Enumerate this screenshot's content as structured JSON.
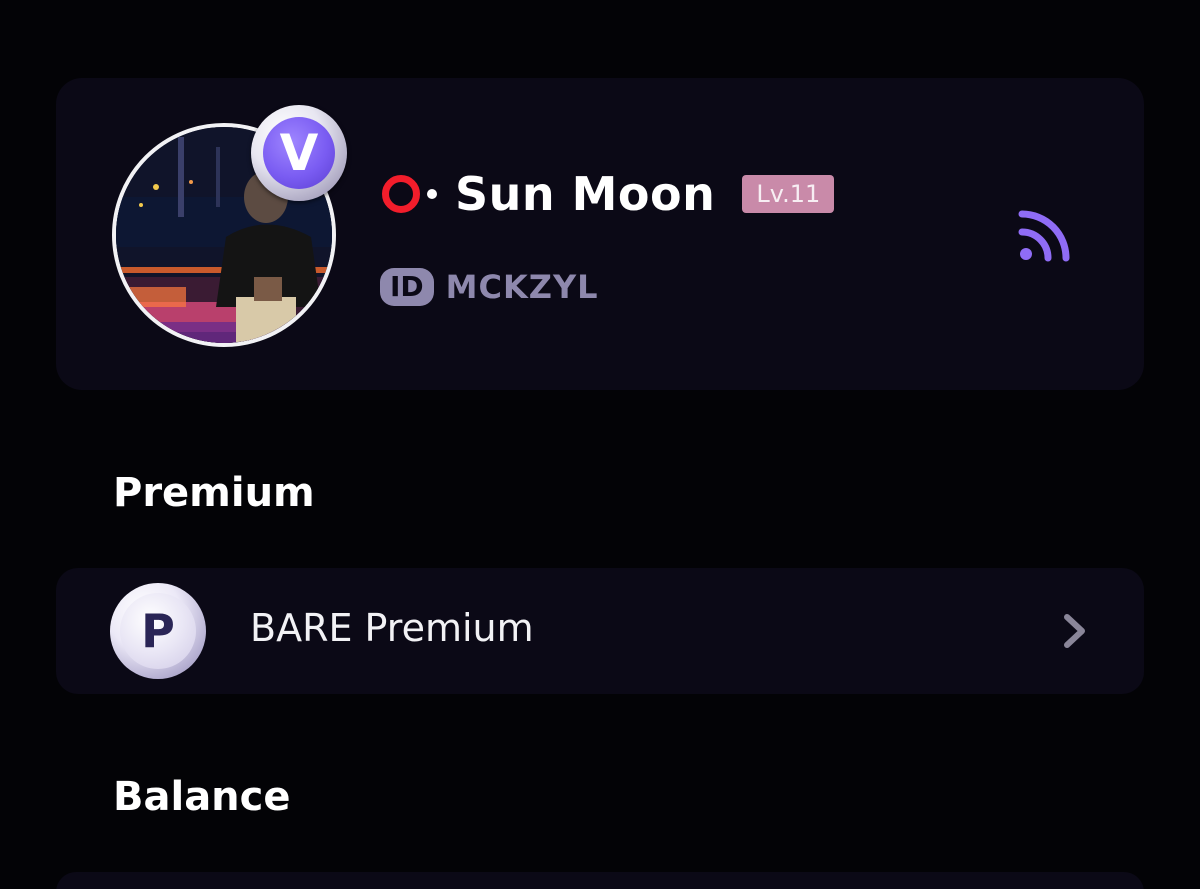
{
  "profile": {
    "display_name": "Sun Moon",
    "level": "Lv.11",
    "id_label": "ID",
    "user_id": "MCKZYL",
    "verified_badge_letter": "V",
    "status_color": "#f21d2b",
    "level_badge_color": "#c98aa9",
    "accent_color": "#8f6cf5",
    "feed_icon": "rss-feed-icon"
  },
  "sections": {
    "premium_title": "Premium",
    "balance_title": "Balance"
  },
  "premium_row": {
    "icon_letter": "P",
    "label": "BARE Premium",
    "chevron_icon": "chevron-right-icon"
  }
}
